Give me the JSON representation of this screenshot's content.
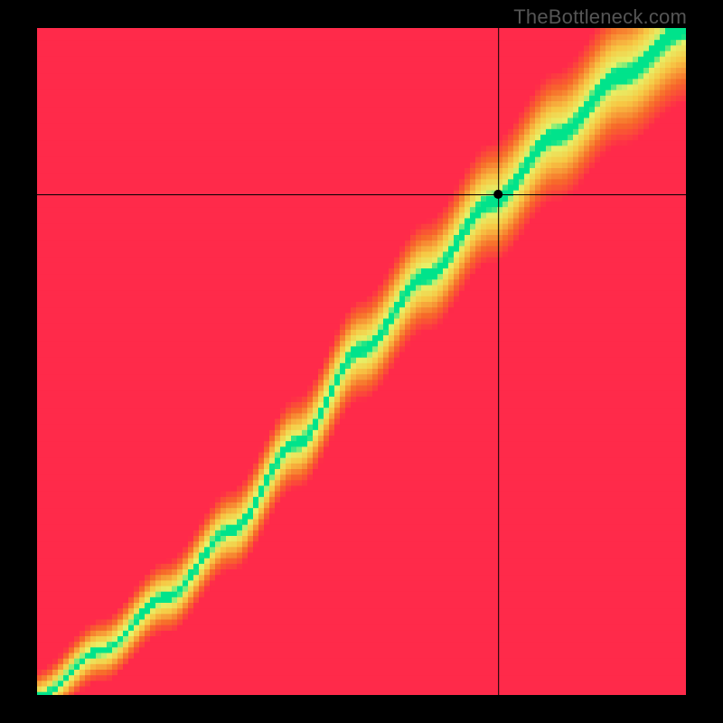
{
  "watermark": "TheBottleneck.com",
  "chart_data": {
    "type": "heatmap",
    "title": "",
    "xlabel": "",
    "ylabel": "",
    "xlim": [
      0,
      100
    ],
    "ylim": [
      0,
      100
    ],
    "grid": false,
    "legend": null,
    "crosshair": {
      "x": 71,
      "y": 75
    },
    "marker": {
      "x": 71,
      "y": 75
    },
    "curve_points": [
      {
        "x": 0,
        "y": 0
      },
      {
        "x": 10,
        "y": 7
      },
      {
        "x": 20,
        "y": 15
      },
      {
        "x": 30,
        "y": 25
      },
      {
        "x": 40,
        "y": 38
      },
      {
        "x": 50,
        "y": 52
      },
      {
        "x": 60,
        "y": 63
      },
      {
        "x": 70,
        "y": 74
      },
      {
        "x": 80,
        "y": 84
      },
      {
        "x": 90,
        "y": 93
      },
      {
        "x": 100,
        "y": 100
      }
    ],
    "band_width_pct": 8,
    "resolution": 120,
    "color_stops_hex": {
      "optimal": "#00e38b",
      "near": "#e6f36a",
      "warn": "#f7c945",
      "bad": "#f76b2a",
      "worst": "#ff2a4a"
    }
  }
}
